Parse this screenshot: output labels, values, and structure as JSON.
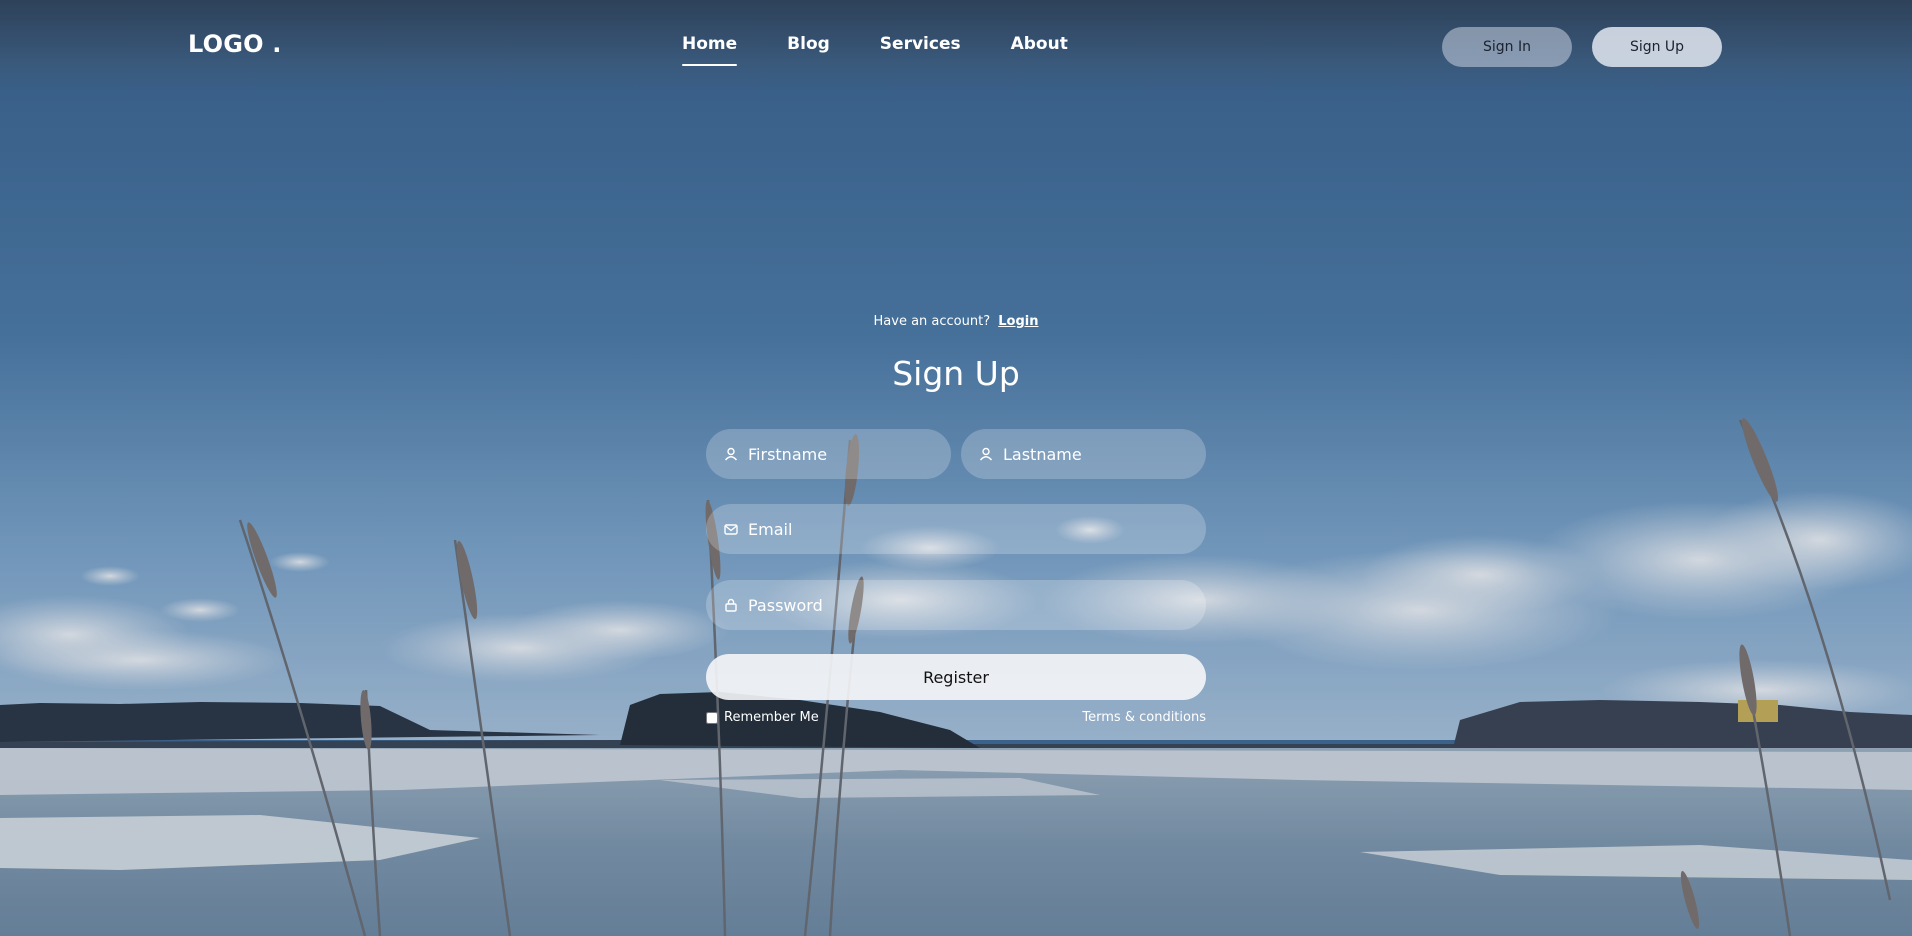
{
  "header": {
    "logo": "LOGO .",
    "nav": [
      "Home",
      "Blog",
      "Services",
      "About"
    ],
    "sign_in": "Sign In",
    "sign_up": "Sign Up"
  },
  "form": {
    "have_account": "Have an account?",
    "login_link": "Login",
    "title": "Sign Up",
    "firstname_placeholder": "Firstname",
    "lastname_placeholder": "Lastname",
    "email_placeholder": "Email",
    "password_placeholder": "Password",
    "register_label": "Register",
    "remember_label": "Remember Me",
    "terms_label": "Terms & conditions"
  },
  "icons": {
    "firstname": "user-icon",
    "lastname": "user-icon",
    "email": "mail-icon",
    "password": "lock-icon"
  },
  "colors": {
    "sky_top": "#3a6591",
    "sky_horizon": "#8fb4d6",
    "ice": "#dfe5ea",
    "water": "#7d98b2"
  }
}
